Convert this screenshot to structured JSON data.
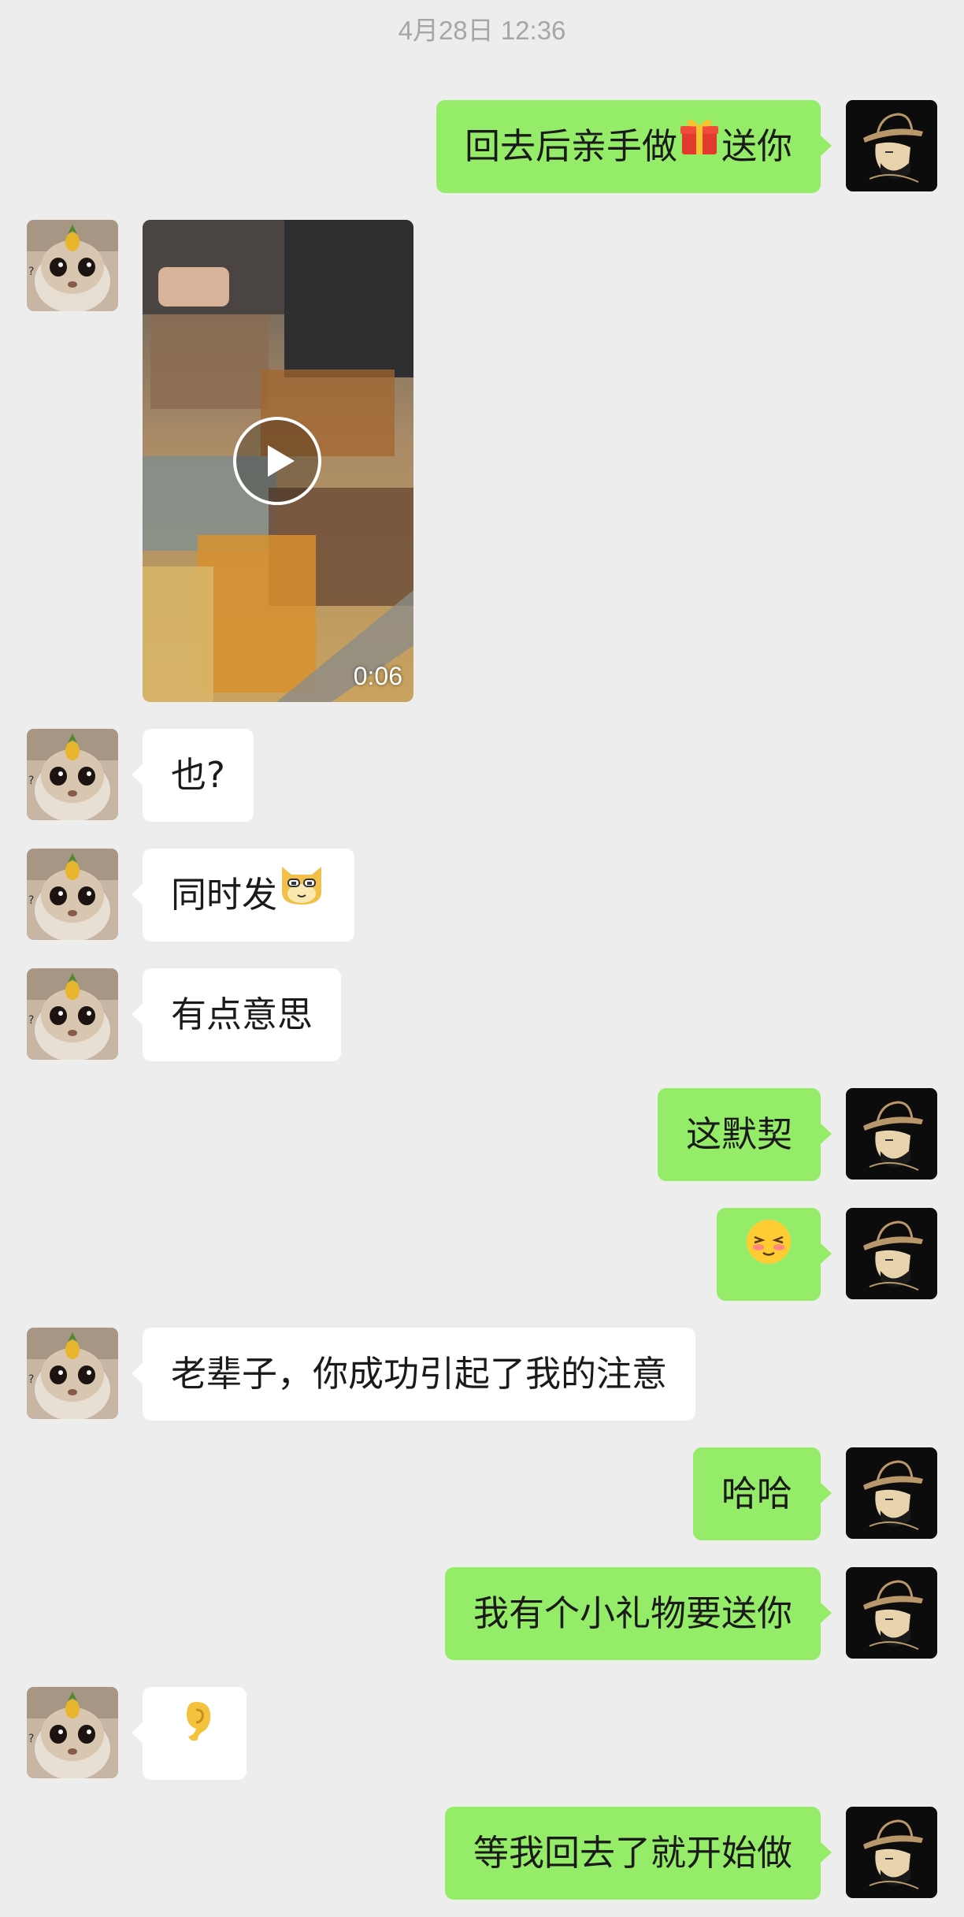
{
  "timestamp": "4月28日 12:36",
  "messages": [
    {
      "side": "right",
      "text": "回去后亲手做",
      "emoji": "gift-emoji",
      "text_after": "送你"
    },
    {
      "side": "left",
      "type": "video",
      "duration": "0:06"
    },
    {
      "side": "left",
      "text": "也?"
    },
    {
      "side": "left",
      "text": "同时发",
      "emoji": "cat-emoji"
    },
    {
      "side": "left",
      "text": "有点意思"
    },
    {
      "side": "right",
      "text": "这默契"
    },
    {
      "side": "right",
      "emoji": "blush-emoji"
    },
    {
      "side": "left",
      "text": "老辈子，你成功引起了我的注意"
    },
    {
      "side": "right",
      "text": "哈哈"
    },
    {
      "side": "right",
      "text": "我有个小礼物要送你"
    },
    {
      "side": "left",
      "emoji": "ear-emoji"
    },
    {
      "side": "right",
      "text": "等我回去了就开始做"
    }
  ],
  "colors": {
    "background": "#ededed",
    "sent_bubble": "#95ec69",
    "received_bubble": "#ffffff",
    "timestamp_text": "#a6a6a6"
  }
}
